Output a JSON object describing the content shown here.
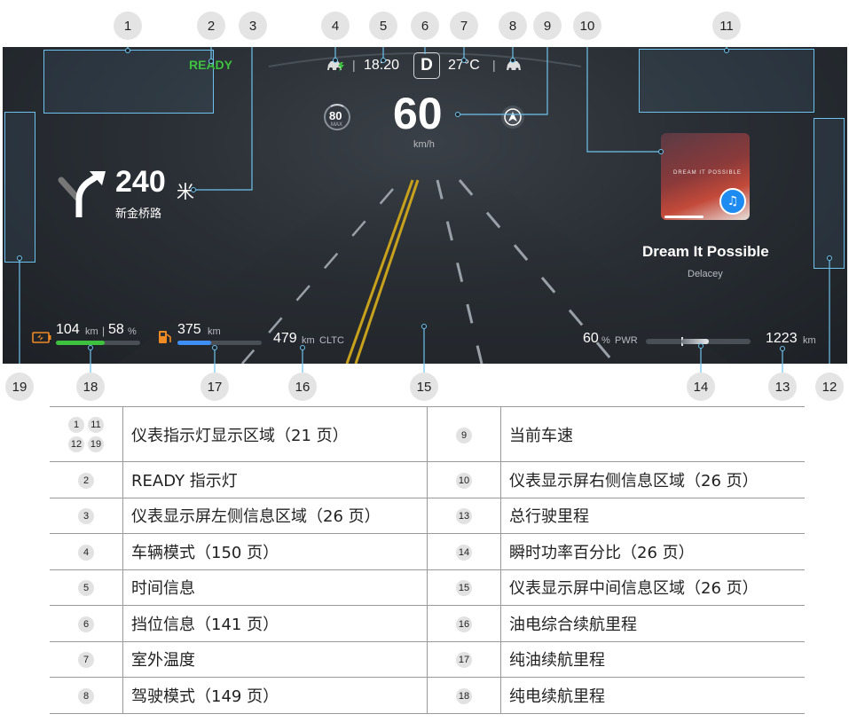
{
  "callout_numbers": [
    "1",
    "2",
    "3",
    "4",
    "5",
    "6",
    "7",
    "8",
    "9",
    "10",
    "11",
    "12",
    "13",
    "14",
    "15",
    "16",
    "17",
    "18",
    "19"
  ],
  "cluster": {
    "ready": "READY",
    "time": "18:20",
    "gear": "D",
    "temperature": "27°C",
    "speed_limit": "80",
    "speed_limit_sub": "MAX",
    "speed": "60",
    "speed_unit": "km/h",
    "nav_distance": "240",
    "nav_distance_unit": "米",
    "nav_road": "新金桥路",
    "song_title": "Dream It Possible",
    "song_artist": "Delacey",
    "album_text": "DREAM IT POSSIBLE",
    "ev_range": "104",
    "ev_range_unit": "km",
    "battery_pct": "58",
    "battery_pct_unit": "%",
    "battery_level": 0.58,
    "fuel_range": "375",
    "fuel_range_unit": "km",
    "fuel_level": 0.4,
    "total_range": "479",
    "total_range_unit": "km",
    "total_range_std": "CLTC",
    "power_pct": "60",
    "power_pct_unit": "%",
    "power_label": "PWR",
    "power_level": 0.6,
    "odometer": "1223",
    "odometer_unit": "km",
    "colors": {
      "ready": "#3ec13e",
      "battery": "#3ec13e",
      "fuel": "#3f8ef5",
      "fuel_icon": "#f08a24",
      "callout": "#6ec3ee"
    }
  },
  "legend": [
    {
      "left_nums": [
        "1",
        "11",
        "12",
        "19"
      ],
      "left_text": "仪表指示灯显示区域（21 页）",
      "right_num": "9",
      "right_text": "当前车速"
    },
    {
      "left_nums": [
        "2"
      ],
      "left_text": "READY 指示灯",
      "right_num": "10",
      "right_text": "仪表显示屏右侧信息区域（26 页）"
    },
    {
      "left_nums": [
        "3"
      ],
      "left_text": "仪表显示屏左侧信息区域（26 页）",
      "right_num": "13",
      "right_text": "总行驶里程"
    },
    {
      "left_nums": [
        "4"
      ],
      "left_text": "车辆模式（150 页）",
      "right_num": "14",
      "right_text": "瞬时功率百分比（26 页）"
    },
    {
      "left_nums": [
        "5"
      ],
      "left_text": "时间信息",
      "right_num": "15",
      "right_text": "仪表显示屏中间信息区域（26 页）"
    },
    {
      "left_nums": [
        "6"
      ],
      "left_text": "挡位信息（141 页）",
      "right_num": "16",
      "right_text": "油电综合续航里程"
    },
    {
      "left_nums": [
        "7"
      ],
      "left_text": "室外温度",
      "right_num": "17",
      "right_text": "纯油续航里程"
    },
    {
      "left_nums": [
        "8"
      ],
      "left_text": "驾驶模式（149 页）",
      "right_num": "18",
      "right_text": "纯电续航里程"
    }
  ]
}
